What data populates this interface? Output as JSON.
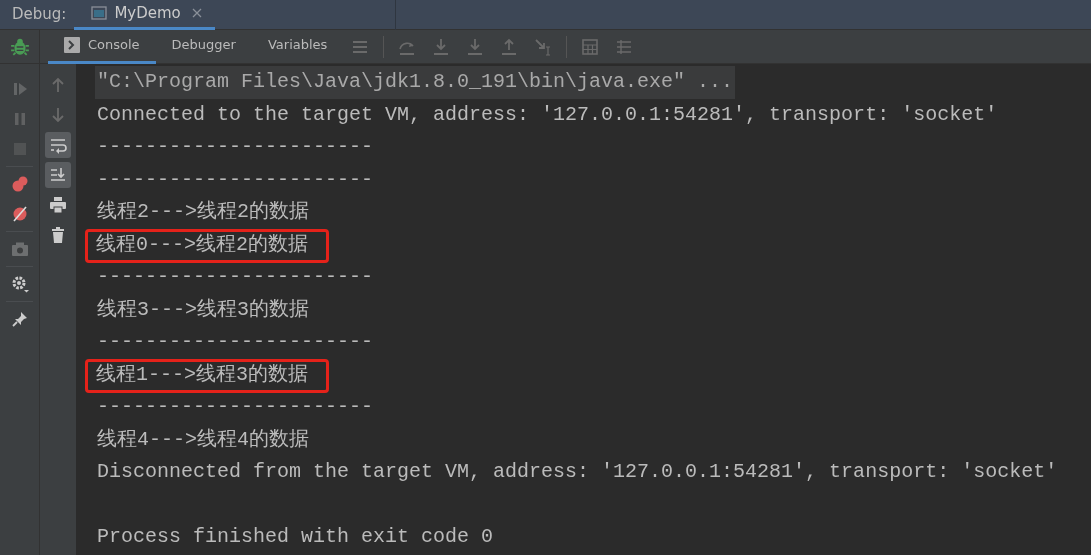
{
  "header": {
    "label": "Debug:",
    "tabs": [
      {
        "title": "MyDemo",
        "selected": true
      }
    ]
  },
  "toolbar_tabs": [
    {
      "label": "Console",
      "selected": true
    },
    {
      "label": "Debugger",
      "selected": false
    },
    {
      "label": "Variables",
      "selected": false
    }
  ],
  "debug_actions": [
    {
      "disabled": true
    },
    {
      "disabled": true
    },
    {
      "disabled": true
    },
    {
      "disabled": false
    },
    {
      "disabled": false
    },
    {
      "disabled": true
    },
    {
      "disabled": false
    },
    {
      "disabled": false
    }
  ],
  "console_tools": [
    {
      "on": false
    },
    {
      "on": false
    },
    {
      "on": true
    },
    {
      "on": true
    },
    {
      "on": false
    },
    {
      "on": false
    }
  ],
  "console_lines": [
    {
      "kind": "command",
      "text": "\"C:\\Program Files\\Java\\jdk1.8.0_191\\bin\\java.exe\" ..."
    },
    {
      "kind": "normal",
      "text": "Connected to the target VM, address: '127.0.0.1:54281', transport: 'socket'"
    },
    {
      "kind": "normal",
      "text": "-----------------------"
    },
    {
      "kind": "normal",
      "text": "-----------------------"
    },
    {
      "kind": "normal",
      "text": "线程2--->线程2的数据"
    },
    {
      "kind": "highlighted",
      "text": "线程0--->线程2的数据"
    },
    {
      "kind": "normal",
      "text": "-----------------------"
    },
    {
      "kind": "normal",
      "text": "线程3--->线程3的数据"
    },
    {
      "kind": "normal",
      "text": "-----------------------"
    },
    {
      "kind": "highlighted",
      "text": "线程1--->线程3的数据"
    },
    {
      "kind": "normal",
      "text": "-----------------------"
    },
    {
      "kind": "normal",
      "text": "线程4--->线程4的数据"
    },
    {
      "kind": "normal",
      "text": "Disconnected from the target VM, address: '127.0.0.1:54281', transport: 'socket'"
    },
    {
      "kind": "blank"
    },
    {
      "kind": "normal",
      "text": "Process finished with exit code 0"
    }
  ]
}
